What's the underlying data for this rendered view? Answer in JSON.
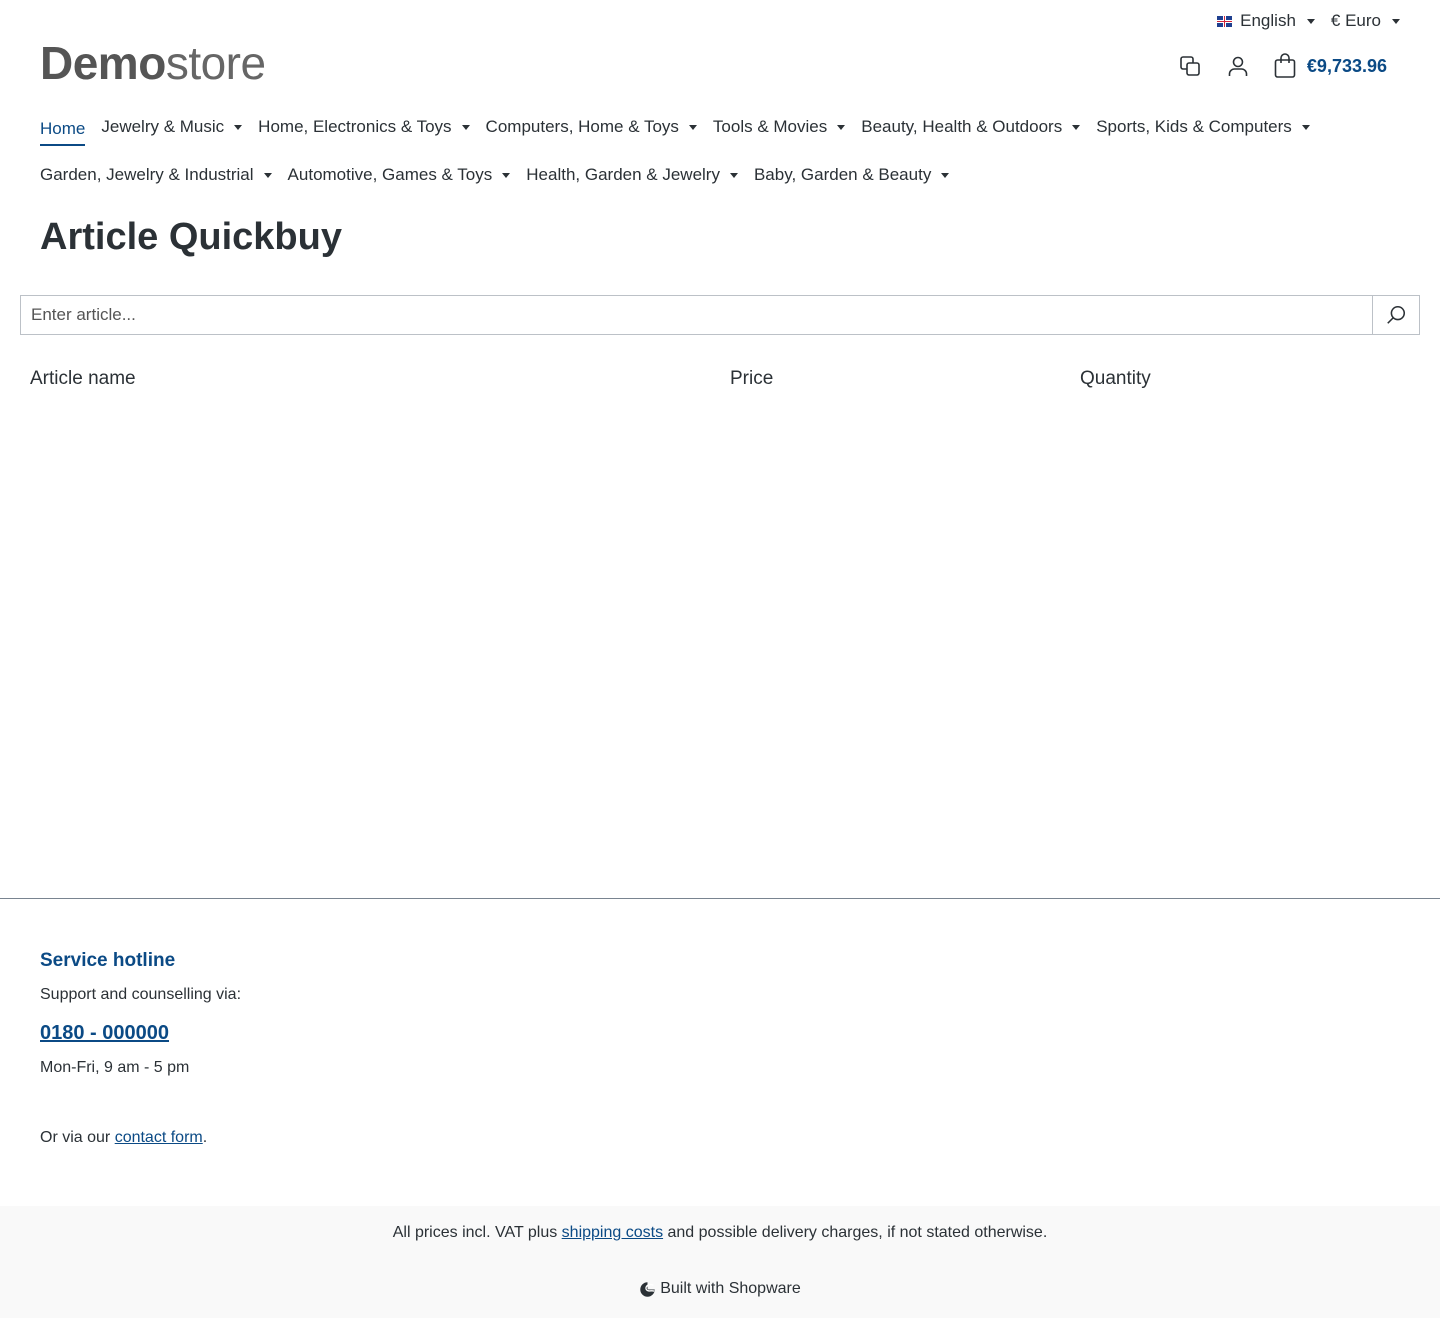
{
  "topbar": {
    "language": "English",
    "currency": "€ Euro"
  },
  "logo": {
    "bold": "Demo",
    "light": "store"
  },
  "header": {
    "cart_total": "€9,733.96"
  },
  "nav": {
    "home": "Home",
    "items": [
      "Jewelry & Music",
      "Home, Electronics & Toys",
      "Computers, Home & Toys",
      "Tools & Movies",
      "Beauty, Health & Outdoors",
      "Sports, Kids & Computers",
      "Garden, Jewelry & Industrial",
      "Automotive, Games & Toys",
      "Health, Garden & Jewelry",
      "Baby, Garden & Beauty"
    ]
  },
  "page": {
    "title": "Article Quickbuy",
    "search_placeholder": "Enter article..."
  },
  "table": {
    "col_name": "Article name",
    "col_price": "Price",
    "col_quantity": "Quantity"
  },
  "footer": {
    "hotline_title": "Service hotline",
    "support_text": "Support and counselling via:",
    "phone": "0180 - 000000",
    "hours": "Mon-Fri, 9 am - 5 pm",
    "contact_prefix": "Or via our ",
    "contact_link": "contact form",
    "contact_suffix": ".",
    "vat_prefix": "All prices incl. VAT plus ",
    "vat_link": "shipping costs",
    "vat_suffix": " and possible delivery charges, if not stated otherwise.",
    "built_with": "Built with Shopware"
  },
  "colors": {
    "accent": "#0b4a85",
    "text": "#2b3136"
  }
}
